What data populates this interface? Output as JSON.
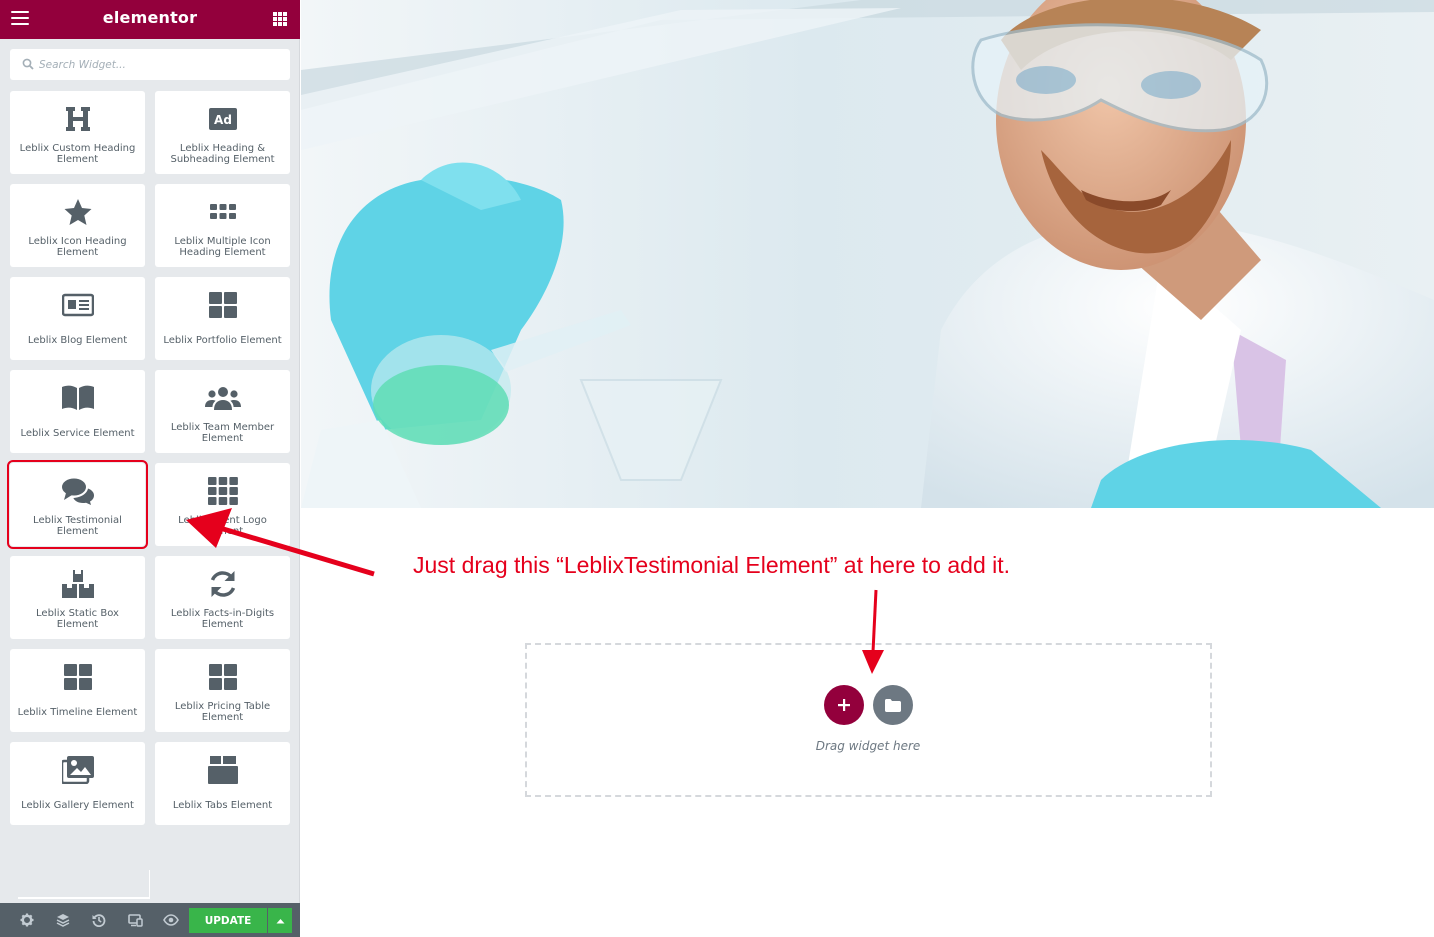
{
  "sidebar": {
    "brand": "elementor",
    "search": {
      "placeholder": "Search Widget...",
      "value": ""
    },
    "widgets": [
      {
        "label": "Leblix Custom Heading Element",
        "icon": "heading-icon"
      },
      {
        "label": "Leblix Heading & Subheading Element",
        "icon": "ad-icon"
      },
      {
        "label": "Leblix Icon Heading Element",
        "icon": "star-icon"
      },
      {
        "label": "Leblix Multiple Icon Heading Element",
        "icon": "icon-grid-icon"
      },
      {
        "label": "Leblix Blog Element",
        "icon": "newspaper-icon"
      },
      {
        "label": "Leblix Portfolio Element",
        "icon": "portfolio-grid-icon"
      },
      {
        "label": "Leblix Service Element",
        "icon": "book-open-icon"
      },
      {
        "label": "Leblix Team Member Element",
        "icon": "users-icon"
      },
      {
        "label": "Leblix Testimonial Element",
        "icon": "chat-bubbles-icon"
      },
      {
        "label": "Leblix Client Logo Element",
        "icon": "nine-grid-icon"
      },
      {
        "label": "Leblix Static Box Element",
        "icon": "boxes-icon"
      },
      {
        "label": "Leblix Facts-in-Digits Element",
        "icon": "refresh-icon"
      },
      {
        "label": "Leblix Timeline Element",
        "icon": "timeline-grid-icon"
      },
      {
        "label": "Leblix Pricing Table Element",
        "icon": "pricing-grid-icon"
      },
      {
        "label": "Leblix Gallery Element",
        "icon": "gallery-icon"
      },
      {
        "label": "Leblix Tabs Element",
        "icon": "tabs-icon"
      }
    ],
    "footer": {
      "update_label": "UPDATE",
      "icons": [
        "settings-icon",
        "layers-icon",
        "history-icon",
        "responsive-icon",
        "preview-eye-icon"
      ]
    }
  },
  "canvas": {
    "annotation": "Just drag this “LeblixTestimonial Element” at here to add it.",
    "drop_hint": "Drag widget here"
  },
  "colors": {
    "brand": "#93003c",
    "update": "#39b54a",
    "annotation": "#e5001c",
    "sidebar_bg": "#e6e9ec",
    "icon": "#556068"
  }
}
